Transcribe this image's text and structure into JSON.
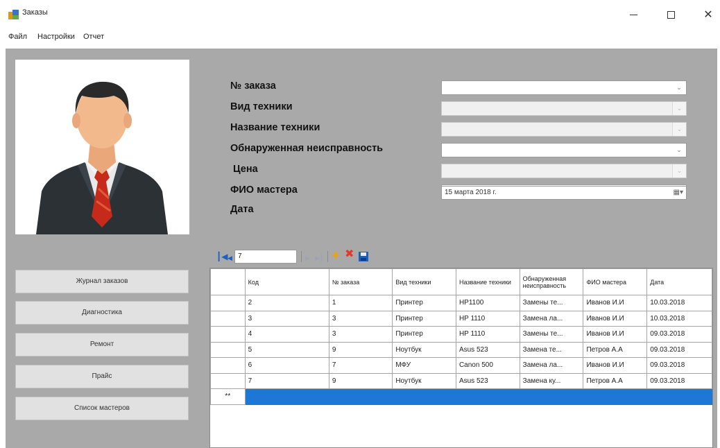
{
  "window": {
    "title": "Заказы"
  },
  "menu": {
    "items": [
      "Файл",
      "Настройки",
      "Отчет"
    ]
  },
  "nav_buttons": [
    "Журнал заказов",
    "Диагностика",
    "Ремонт",
    "Прайс",
    "Список мастеров"
  ],
  "form": {
    "labels": [
      "№ заказа",
      "Вид техники",
      "Название техники",
      "Обнаруженная неисправность",
      "Цена",
      "ФИО мастера",
      "Дата"
    ],
    "date_value": "15  марта  2018 г."
  },
  "navigator": {
    "position": "7"
  },
  "grid": {
    "columns": [
      "Код",
      "№ заказа",
      "Вид техники",
      "Название техники",
      "Обнаруженная неисправность",
      "ФИО мастера",
      "Дата"
    ],
    "rows": [
      [
        "2",
        "1",
        "Принтер",
        "HP1100",
        "Замены те...",
        "Иванов И.И",
        "10.03.2018"
      ],
      [
        "3",
        "3",
        "Принтер",
        "HP 1110",
        "Замена ла...",
        "Иванов И.И",
        "10.03.2018"
      ],
      [
        "4",
        "3",
        "Принтер",
        "HP 1110",
        "Замены те...",
        "Иванов И.И",
        "09.03.2018"
      ],
      [
        "5",
        "9",
        "Ноутбук",
        "Asus 523",
        "Замена те...",
        "Петров А.А",
        "09.03.2018"
      ],
      [
        "6",
        "7",
        "МФУ",
        "Canon 500",
        "Замена ла...",
        "Иванов И.И",
        "09.03.2018"
      ],
      [
        "7",
        "9",
        "Ноутбук",
        "Asus 523",
        "Замена ку...",
        "Петров А.А",
        "09.03.2018"
      ]
    ],
    "new_row_marker": "**"
  },
  "icons": {
    "window": "app-icon",
    "navigator": [
      "move-first-icon",
      "move-previous-icon",
      "move-next-icon",
      "move-last-icon",
      "add-new-icon",
      "delete-icon",
      "save-icon"
    ]
  },
  "colors": {
    "surface": "#a9a9a9",
    "selection": "#1e76d7",
    "delete": "#e23a2a",
    "add": "#e8a317",
    "save": "#1f5fbf"
  }
}
